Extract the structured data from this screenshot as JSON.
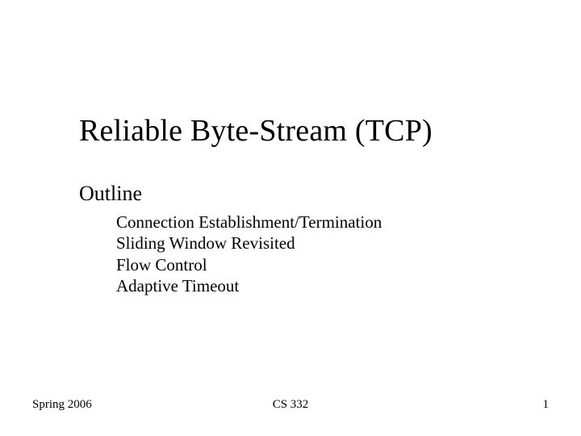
{
  "title": "Reliable Byte-Stream (TCP)",
  "outline_label": "Outline",
  "outline_items": [
    "Connection Establishment/Termination",
    "Sliding Window Revisited",
    "Flow Control",
    "Adaptive Timeout"
  ],
  "footer": {
    "left": "Spring 2006",
    "center": "CS 332",
    "right": "1"
  }
}
